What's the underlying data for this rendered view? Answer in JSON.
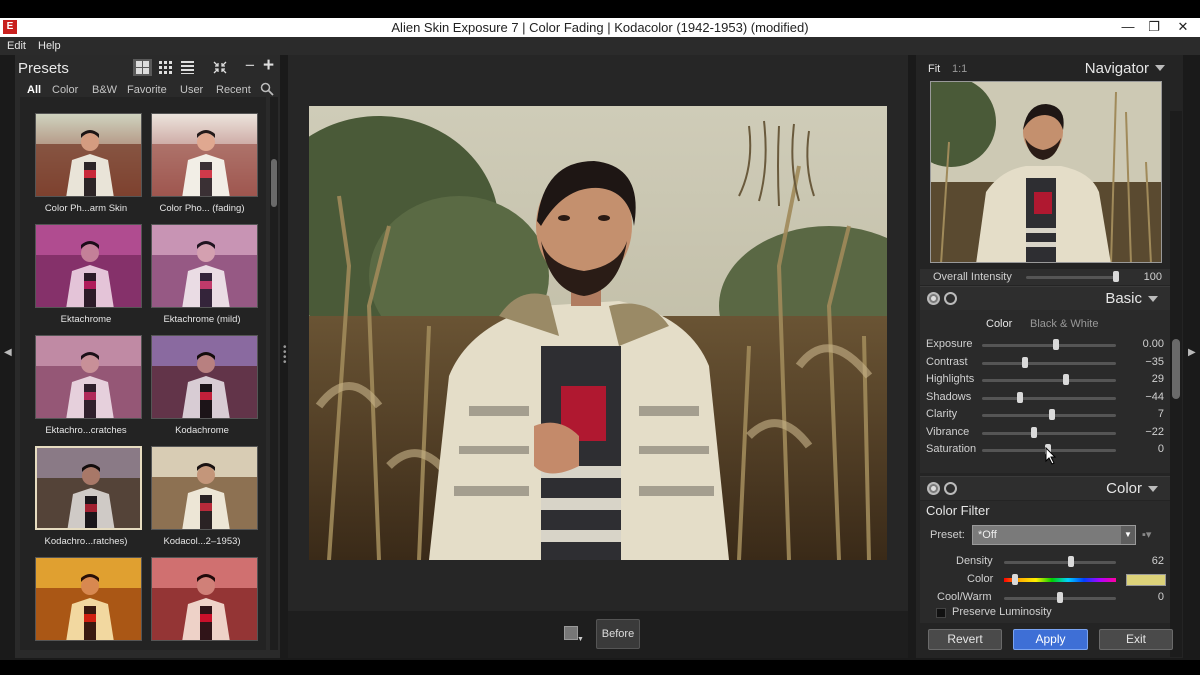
{
  "window": {
    "title": "Alien Skin Exposure 7 | Color Fading | Kodacolor (1942-1953) (modified)",
    "app_icon_letter": "E",
    "min_glyph": "—",
    "max_glyph": "❐",
    "close_glyph": "✕"
  },
  "menu": {
    "edit": "Edit",
    "help": "Help"
  },
  "presets": {
    "title": "Presets",
    "minus": "−",
    "plus": "+",
    "tabs": [
      "All",
      "Color",
      "B&W",
      "Favorite",
      "User",
      "Recent"
    ],
    "items": [
      {
        "caption": "Color Ph...arm Skin"
      },
      {
        "caption": "Color Pho... (fading)"
      },
      {
        "caption": "Ektachrome"
      },
      {
        "caption": "Ektachrome (mild)"
      },
      {
        "caption": "Ektachro...cratches"
      },
      {
        "caption": "Kodachrome"
      },
      {
        "caption": "Kodachro...ratches)"
      },
      {
        "caption": "Kodacol...2–1953)"
      }
    ]
  },
  "center": {
    "before_label": "Before"
  },
  "navigator": {
    "fit": "Fit",
    "one_to_one": "1:1",
    "title": "Navigator",
    "intensity_label": "Overall Intensity",
    "intensity_value": "100",
    "intensity_fraction": 1.0
  },
  "basic": {
    "title": "Basic",
    "tab_color": "Color",
    "tab_bw": "Black & White",
    "sliders": [
      {
        "label": "Exposure",
        "value": "0.00",
        "pos": 0.55
      },
      {
        "label": "Contrast",
        "value": "−35",
        "pos": 0.32
      },
      {
        "label": "Highlights",
        "value": "29",
        "pos": 0.63
      },
      {
        "label": "Shadows",
        "value": "−44",
        "pos": 0.28
      },
      {
        "label": "Clarity",
        "value": "7",
        "pos": 0.52
      },
      {
        "label": "Vibrance",
        "value": "−22",
        "pos": 0.39
      },
      {
        "label": "Saturation",
        "value": "0",
        "pos": 0.49
      }
    ]
  },
  "color": {
    "title": "Color",
    "filter_title": "Color Filter",
    "preset_label": "Preset:",
    "preset_value": "*Off",
    "density_label": "Density",
    "density_value": "62",
    "density_pos": 0.6,
    "color_label": "Color",
    "color_pos": 0.1,
    "chip_color": "#dcd27a",
    "coolwarm_label": "Cool/Warm",
    "coolwarm_value": "0",
    "coolwarm_pos": 0.5,
    "preserve_label": "Preserve Luminosity"
  },
  "buttons": {
    "revert": "Revert",
    "apply": "Apply",
    "exit": "Exit"
  },
  "colors": {
    "accent": "#3e6fd6",
    "titlebar": "#ffffff",
    "panel": "#2a2a2a"
  }
}
